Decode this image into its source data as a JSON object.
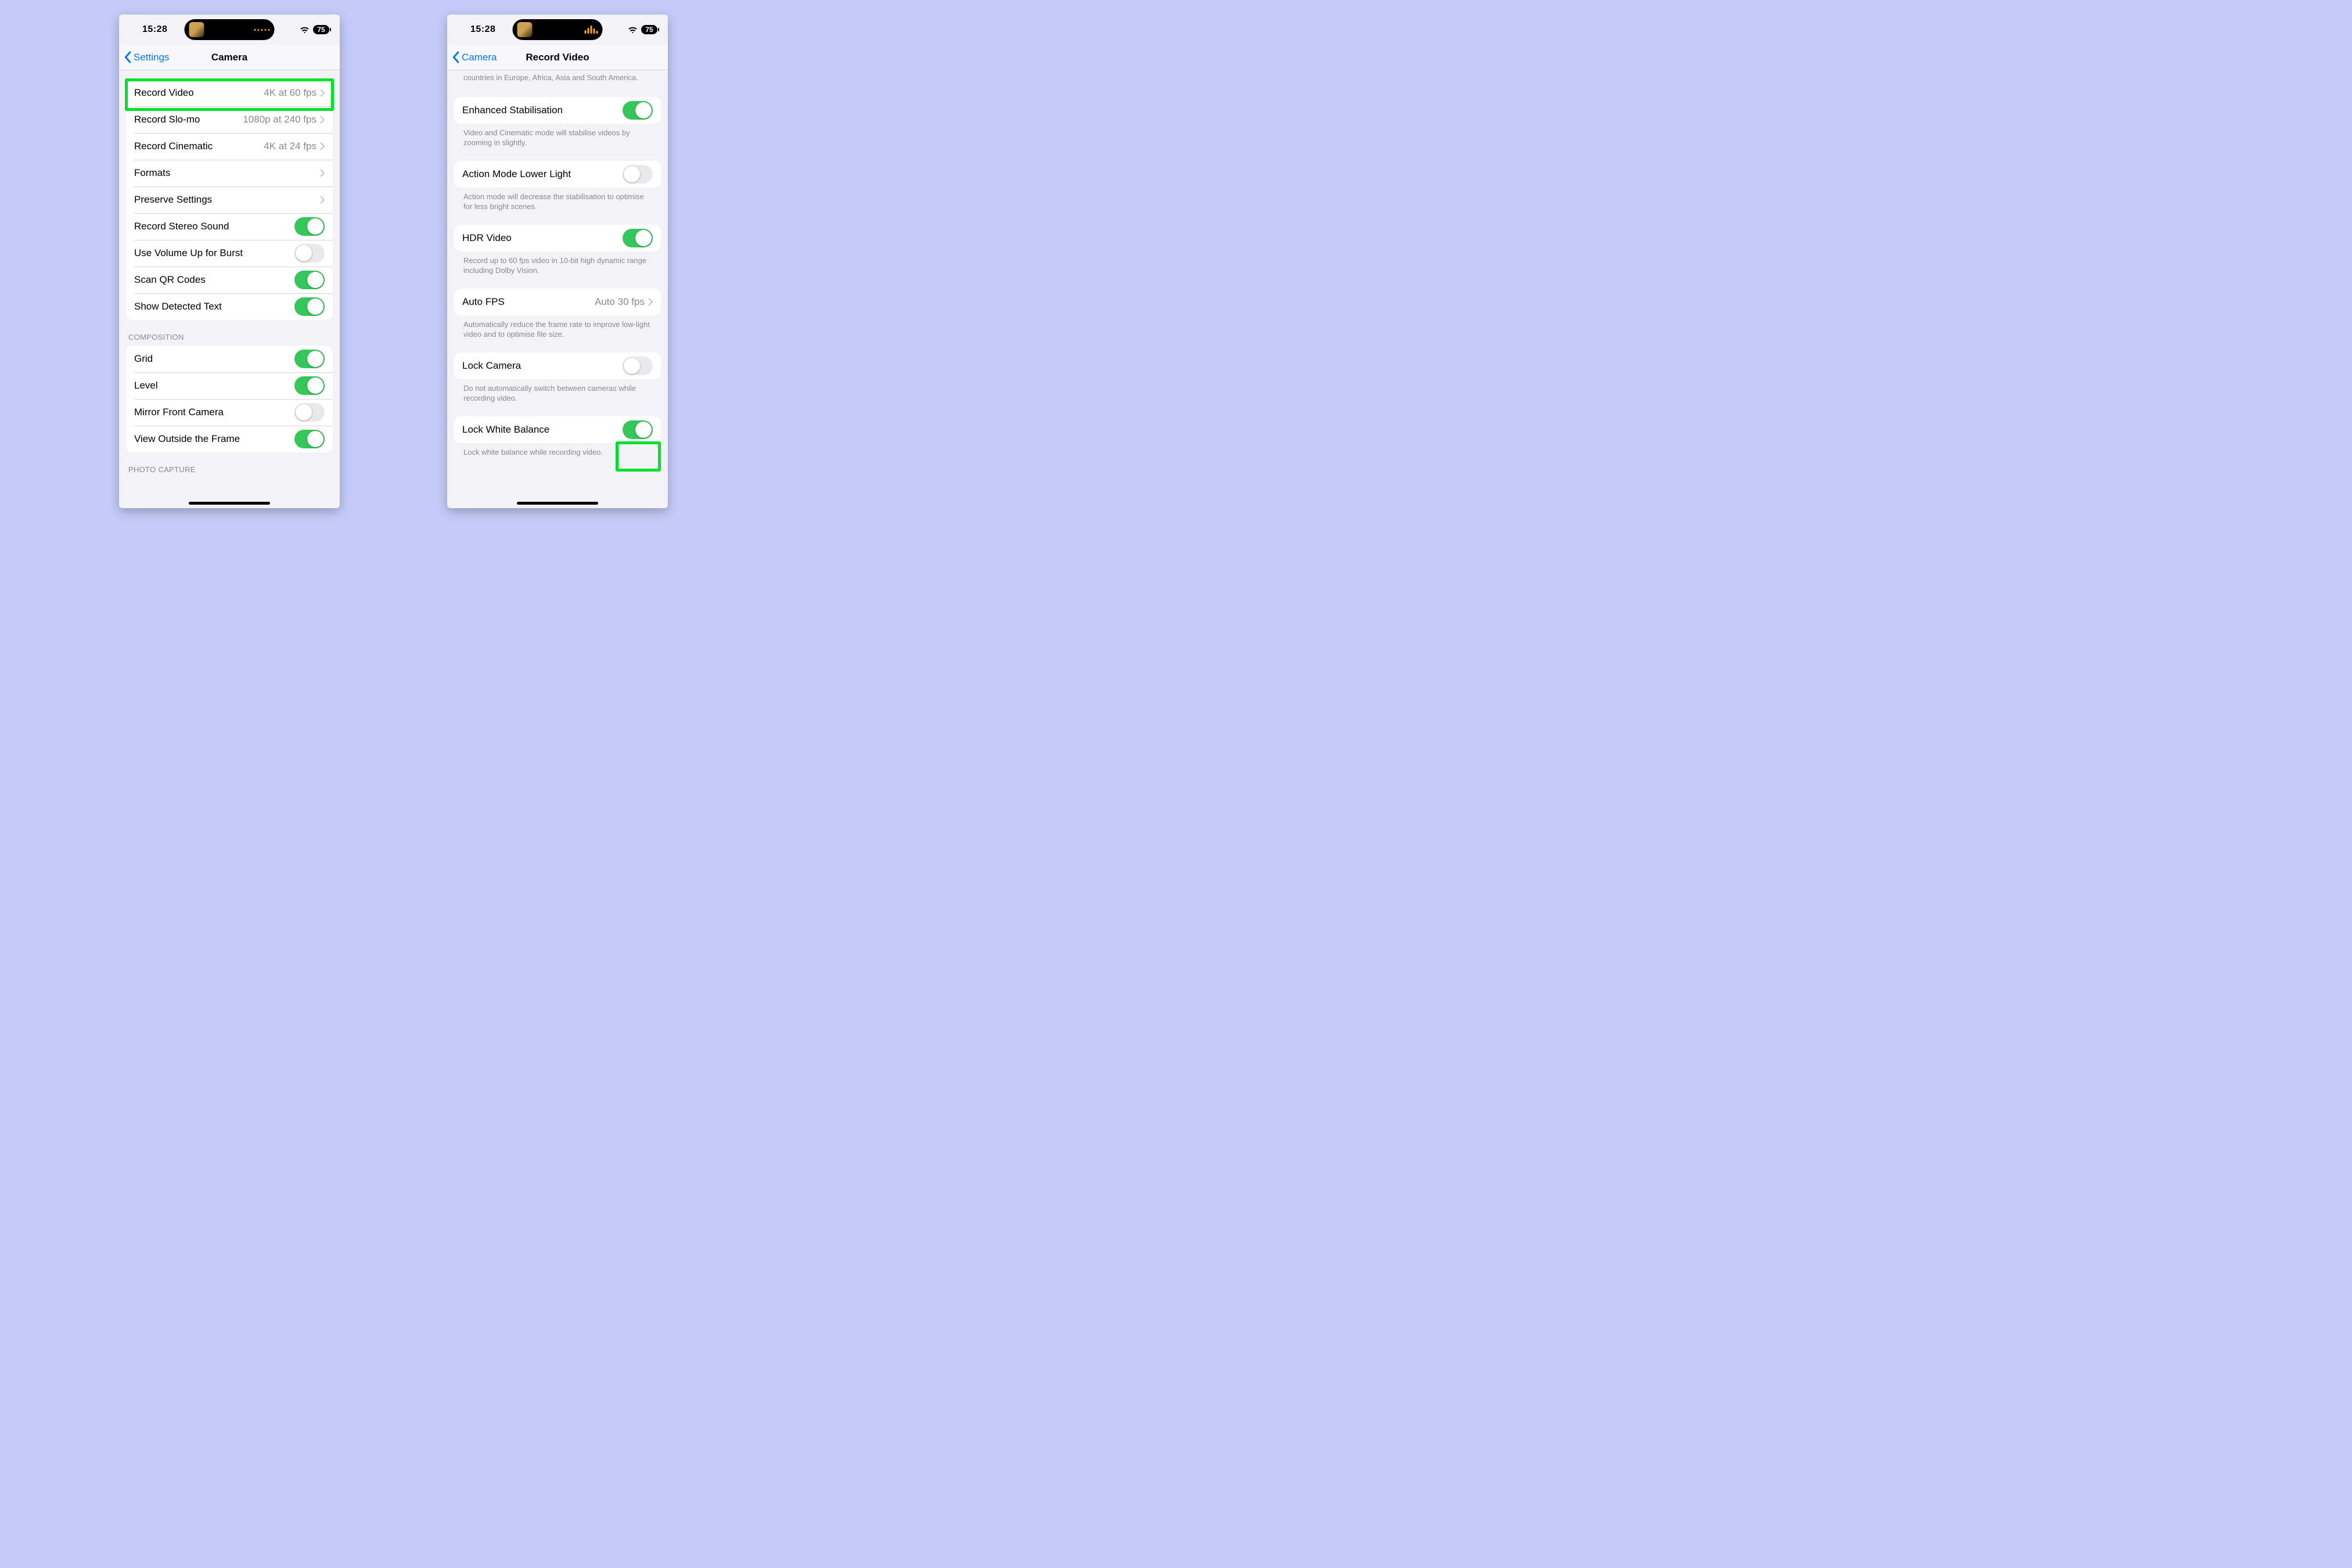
{
  "status": {
    "time": "15:28",
    "battery_pct": "75"
  },
  "left": {
    "nav": {
      "back": "Settings",
      "title": "Camera"
    },
    "rows": {
      "record_video": {
        "label": "Record Video",
        "value": "4K at 60 fps"
      },
      "record_slomo": {
        "label": "Record Slo-mo",
        "value": "1080p at 240 fps"
      },
      "record_cinem": {
        "label": "Record Cinematic",
        "value": "4K at 24 fps"
      },
      "formats": {
        "label": "Formats"
      },
      "preserve": {
        "label": "Preserve Settings"
      },
      "stereo": {
        "label": "Record Stereo Sound"
      },
      "volume_burst": {
        "label": "Use Volume Up for Burst"
      },
      "scan_qr": {
        "label": "Scan QR Codes"
      },
      "detected_text": {
        "label": "Show Detected Text"
      }
    },
    "section_composition": "Composition",
    "comp": {
      "grid": {
        "label": "Grid"
      },
      "level": {
        "label": "Level"
      },
      "mirror": {
        "label": "Mirror Front Camera"
      },
      "outside": {
        "label": "View Outside the Frame"
      }
    },
    "section_photo_capture": "Photo Capture"
  },
  "right": {
    "nav": {
      "back": "Camera",
      "title": "Record Video"
    },
    "pal_partial": "countries in Europe, Africa, Asia and South America.",
    "enh_stab": {
      "label": "Enhanced Stabilisation"
    },
    "enh_stab_foot": "Video and Cinematic mode will stabilise videos by zooming in slightly.",
    "action_low": {
      "label": "Action Mode Lower Light"
    },
    "action_low_foot": "Action mode will decrease the stabilisation to optimise for less bright scenes.",
    "hdr": {
      "label": "HDR Video"
    },
    "hdr_foot": "Record up to 60 fps video in 10-bit high dynamic range including Dolby Vision.",
    "autofps": {
      "label": "Auto FPS",
      "value": "Auto 30 fps"
    },
    "autofps_foot": "Automatically reduce the frame rate to improve low-light video and to optimise file size.",
    "lock_cam": {
      "label": "Lock Camera"
    },
    "lock_cam_foot": "Do not automatically switch between cameras while recording video.",
    "lock_wb": {
      "label": "Lock White Balance"
    },
    "lock_wb_foot": "Lock white balance while recording video."
  },
  "toggles": {
    "stereo": true,
    "volume_burst": false,
    "scan_qr": true,
    "detected_text": true,
    "grid": true,
    "level": true,
    "mirror": false,
    "outside": true,
    "enh_stab": true,
    "action_low": false,
    "hdr": true,
    "lock_cam": false,
    "lock_wb": true
  },
  "colors": {
    "accent_blue": "#007aff",
    "switch_on": "#34c759",
    "highlight": "#00e32a"
  }
}
